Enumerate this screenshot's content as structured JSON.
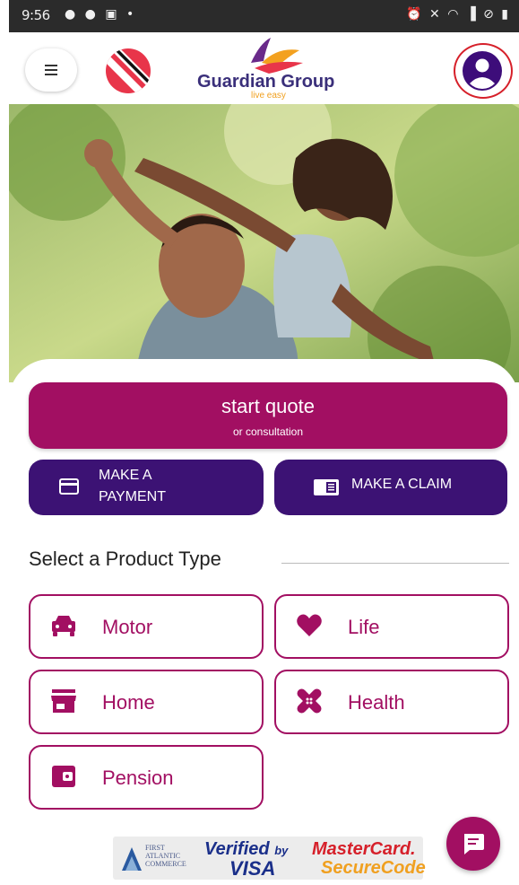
{
  "status_bar": {
    "time": "9:56",
    "left_icons": "● ● ▣ •",
    "right_icons": "⏰ ✕ ◠ ▐ ⊘ ▮"
  },
  "header": {
    "brand_name": "Guardian Group",
    "brand_tagline": "live easy",
    "menu_icon": "hamburger-icon",
    "flag_icon": "trinidad-flag-icon",
    "profile_icon": "account-circle-icon"
  },
  "actions": {
    "quote_label": "start quote",
    "quote_sublabel": "or consultation",
    "payment_label_1": "MAKE A",
    "payment_label_2": "PAYMENT",
    "claim_label": "MAKE A CLAIM"
  },
  "products": {
    "section_title": "Select a Product Type",
    "items": [
      {
        "label": "Motor",
        "icon": "car-icon"
      },
      {
        "label": "Life",
        "icon": "heart-icon"
      },
      {
        "label": "Home",
        "icon": "store-icon"
      },
      {
        "label": "Health",
        "icon": "bandage-icon"
      },
      {
        "label": "Pension",
        "icon": "wallet-icon"
      }
    ]
  },
  "badge": {
    "fac_text_1": "FIRST",
    "fac_text_2": "ATLANTIC",
    "fac_text_3": "COMMERCE",
    "verified": "Verified",
    "by": "by",
    "visa": "VISA",
    "mastercard": "MasterCard.",
    "securecode": "SecureCode"
  },
  "colors": {
    "primary": "#a20f62",
    "secondary": "#3c1274",
    "status_bar": "#2b2b2b"
  }
}
